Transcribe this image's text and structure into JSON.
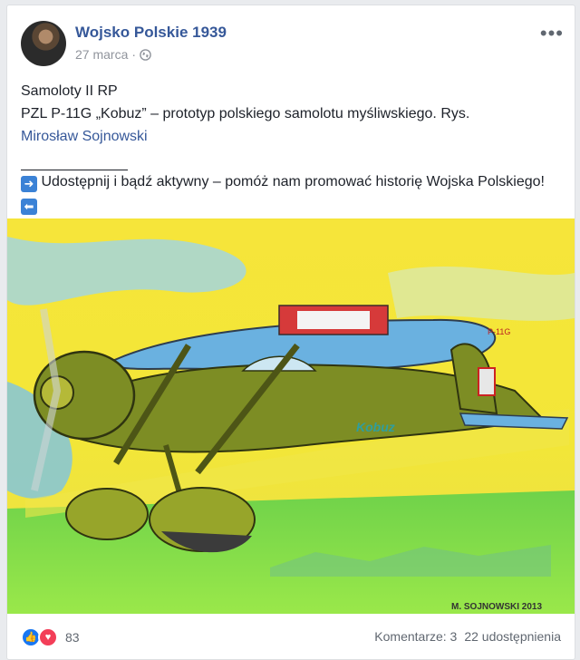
{
  "post": {
    "page_name": "Wojsko Polskie 1939",
    "date": "27 marca",
    "separator": "·",
    "privacy_icon": "globe-icon",
    "more_icon": "more-horizontal-icon",
    "line1": "Samoloty II RP",
    "line2": "PZL P-11G „Kobuz” – prototyp polskiego samolotu myśliwskiego. Rys.",
    "author": "Mirosław Sojnowski",
    "share_prefix_icon": "➡️",
    "share_text": "Udostępnij i bądź aktywny – pomóż nam promować historię Wojska Polskiego!",
    "share_suffix_icon": "⬅️"
  },
  "image": {
    "plane_logo": "Kobuz",
    "plane_code": "P-11G",
    "signature": "M. SOJNOWSKI 2013"
  },
  "footer": {
    "reaction_count": "83",
    "comments": "Komentarze: 3",
    "shares": "22 udostępnienia"
  },
  "colors": {
    "link": "#365899",
    "like": "#1877f2",
    "love": "#f33e58"
  }
}
